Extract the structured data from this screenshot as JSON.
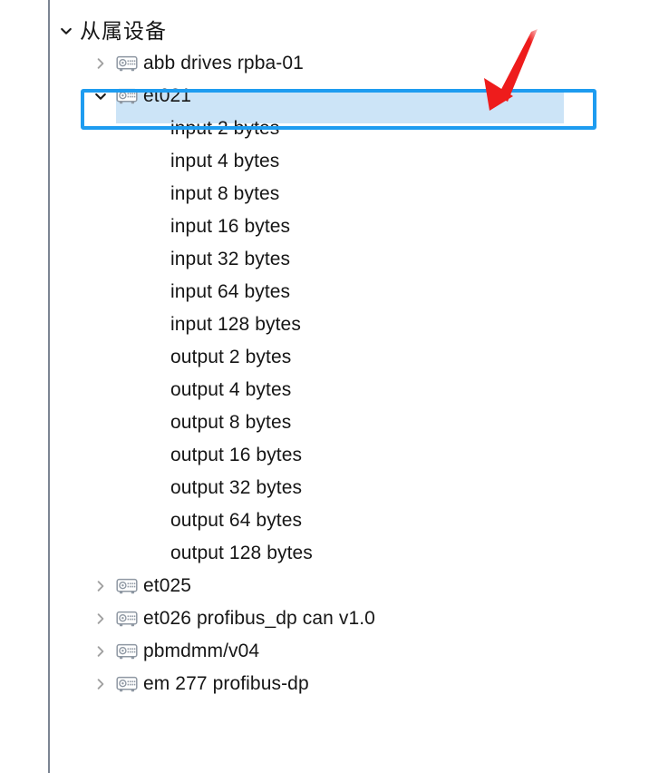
{
  "panel": {
    "root": {
      "label": "从属设备",
      "expanded": true,
      "twisty_icon": "chevron-down-icon"
    },
    "nodes": [
      {
        "label": "abb drives rpba-01",
        "icon": "device-module-icon",
        "twisty_icon": "chevron-right-icon",
        "expanded": false,
        "selected": false,
        "level": 1
      },
      {
        "label": "et021",
        "icon": "device-module-icon",
        "twisty_icon": "chevron-down-icon",
        "expanded": true,
        "selected": true,
        "level": 1
      },
      {
        "label": "input 2 bytes",
        "icon": null,
        "twisty_icon": null,
        "expanded": false,
        "selected": false,
        "level": 2
      },
      {
        "label": "input 4 bytes",
        "icon": null,
        "twisty_icon": null,
        "expanded": false,
        "selected": false,
        "level": 2
      },
      {
        "label": "input 8 bytes",
        "icon": null,
        "twisty_icon": null,
        "expanded": false,
        "selected": false,
        "level": 2
      },
      {
        "label": "input 16 bytes",
        "icon": null,
        "twisty_icon": null,
        "expanded": false,
        "selected": false,
        "level": 2
      },
      {
        "label": "input 32 bytes",
        "icon": null,
        "twisty_icon": null,
        "expanded": false,
        "selected": false,
        "level": 2
      },
      {
        "label": "input 64 bytes",
        "icon": null,
        "twisty_icon": null,
        "expanded": false,
        "selected": false,
        "level": 2
      },
      {
        "label": "input 128 bytes",
        "icon": null,
        "twisty_icon": null,
        "expanded": false,
        "selected": false,
        "level": 2
      },
      {
        "label": "output 2 bytes",
        "icon": null,
        "twisty_icon": null,
        "expanded": false,
        "selected": false,
        "level": 2
      },
      {
        "label": "output 4 bytes",
        "icon": null,
        "twisty_icon": null,
        "expanded": false,
        "selected": false,
        "level": 2
      },
      {
        "label": "output 8 bytes",
        "icon": null,
        "twisty_icon": null,
        "expanded": false,
        "selected": false,
        "level": 2
      },
      {
        "label": "output 16 bytes",
        "icon": null,
        "twisty_icon": null,
        "expanded": false,
        "selected": false,
        "level": 2
      },
      {
        "label": "output 32 bytes",
        "icon": null,
        "twisty_icon": null,
        "expanded": false,
        "selected": false,
        "level": 2
      },
      {
        "label": "output 64 bytes",
        "icon": null,
        "twisty_icon": null,
        "expanded": false,
        "selected": false,
        "level": 2
      },
      {
        "label": "output 128 bytes",
        "icon": null,
        "twisty_icon": null,
        "expanded": false,
        "selected": false,
        "level": 2
      },
      {
        "label": "et025",
        "icon": "device-module-icon",
        "twisty_icon": "chevron-right-icon",
        "expanded": false,
        "selected": false,
        "level": 1
      },
      {
        "label": "et026 profibus_dp can v1.0",
        "icon": "device-module-icon",
        "twisty_icon": "chevron-right-icon",
        "expanded": false,
        "selected": false,
        "level": 1
      },
      {
        "label": "pbmdmm/v04",
        "icon": "device-module-icon",
        "twisty_icon": "chevron-right-icon",
        "expanded": false,
        "selected": false,
        "level": 1
      },
      {
        "label": "em 277 profibus-dp",
        "icon": "device-module-icon",
        "twisty_icon": "chevron-right-icon",
        "expanded": false,
        "selected": false,
        "level": 1
      }
    ]
  },
  "annotations": {
    "highlight_box": {
      "shape": "rectangle",
      "color": "#1e9cf0",
      "target_label": "et021"
    },
    "arrow": {
      "shape": "arrow",
      "color": "#ee1c1c",
      "points_to": "et021"
    }
  },
  "colors": {
    "selection_band": "#cce4f7",
    "annotation_blue": "#1e9cf0",
    "annotation_red": "#ee1c1c",
    "text": "#161616",
    "twisty_collapsed": "#a0a0a0",
    "twisty_expanded": "#1c1c1c",
    "panel_rule": "#7c8593",
    "icon_gray": "#8f98a3"
  }
}
